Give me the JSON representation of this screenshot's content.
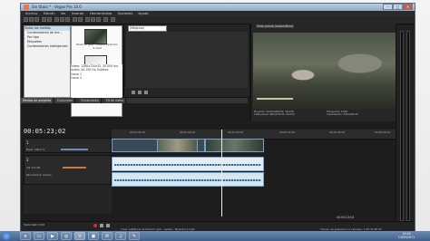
{
  "window": {
    "title": "Sin título * - Vegas Pro 10.0",
    "buttons": [
      "–",
      "□",
      "✕"
    ]
  },
  "menu": [
    "Archivo",
    "Edición",
    "Ver",
    "Insertar",
    "Herramientas",
    "Opciones",
    "Ayuda"
  ],
  "project_media": {
    "tree": [
      "Todos los medios",
      "Contenedores de me...",
      "Por tipo",
      "Etiquetas",
      "Contenedores inteligentes"
    ],
    "clips": [
      {
        "label": "Road to gold - Avatar Episodio 2.mp4"
      },
      {
        "label": "Road to gold - Avatar Episodio 2.mp4"
      }
    ],
    "properties": [
      "Vídeo: 1280x720x32, 30,000 fps",
      "Audio: 44.100 Hz, Estéreo",
      "Canal 1",
      "Canal 2"
    ],
    "tabs": [
      "Medios de proyecto",
      "Explorador",
      "Transiciones",
      "FX de vídeo"
    ]
  },
  "trimmer": {
    "dropdown": "(Ninguno)"
  },
  "preview": {
    "mode": "Vista previa (automático)",
    "info": [
      "Proyecto: 1920x1080x32, 29,970i",
      "Vista previa: 480x270x32, 29,970i",
      "Fotograma: 2.684",
      "Visualización: 320x180x32"
    ]
  },
  "timeline": {
    "timecode": "00:05:23;02",
    "ruler": [
      "00:04:44;29",
      "00:05:04;29",
      "00:05:24;29",
      "00:05:44;29",
      "00:06:04;29",
      "00:06:24;29"
    ],
    "tracks": [
      {
        "num": "1",
        "level": "Nivel: 100,0 %"
      },
      {
        "num": "2",
        "volume": "Vol: 0,0 dB",
        "pan": "Panorámica: Centro"
      }
    ],
    "end_time": "00:05:23;02"
  },
  "status": {
    "rate": "Velocidad: 0,00",
    "file": "Crear subtítulos de Road to gold - Avatar - Episodio 2.mp4",
    "record": "Tiempo de grabación (2 canales): 1:45:32:46:20"
  },
  "taskbar": {
    "clock": "19:00",
    "date": "13/03/2011"
  },
  "accent": "#7aa2c8"
}
